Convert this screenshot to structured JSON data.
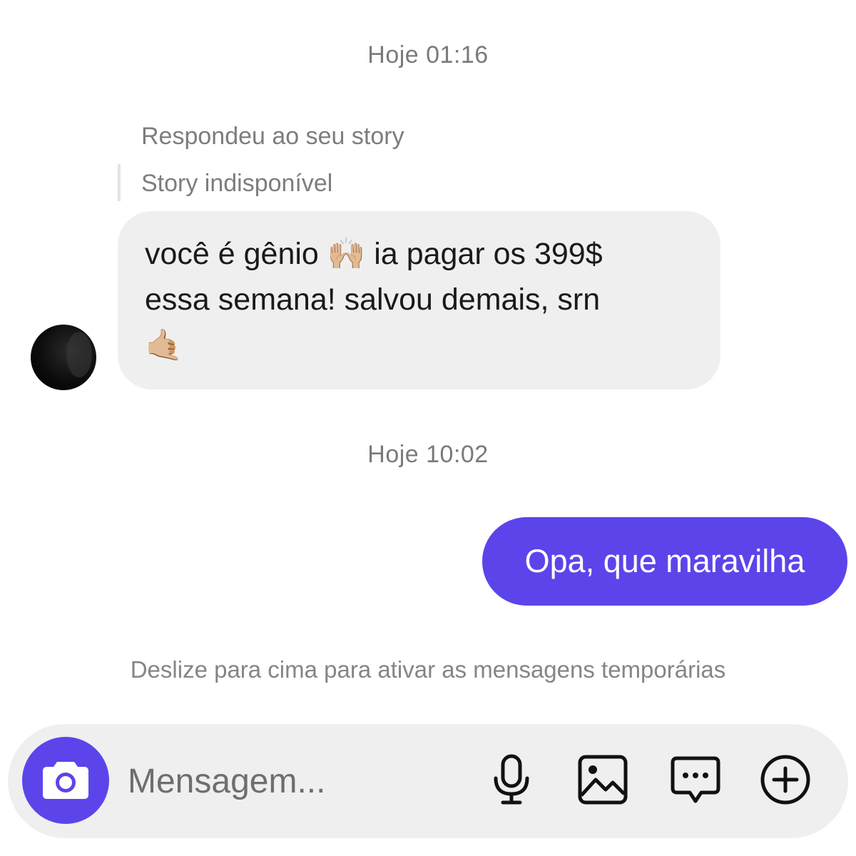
{
  "conversation": {
    "timestamp_1": "Hoje 01:16",
    "reply_header": "Respondeu ao seu story",
    "reply_story": "Story indisponível",
    "incoming_message": "você é gênio 🙌🏼 ia pagar os 399$\nessa semana! salvou demais, srn\n🤙🏼",
    "timestamp_2": "Hoje 10:02",
    "outgoing_message": "Opa, que maravilha",
    "hint": "Deslize para cima para ativar as mensagens temporárias"
  },
  "composer": {
    "placeholder": "Mensagem...",
    "icons": [
      "camera-icon",
      "microphone-icon",
      "image-icon",
      "message-bubble-icon",
      "plus-circle-icon"
    ]
  },
  "colors": {
    "accent": "#5b45ea",
    "incoming_bubble": "#efefef",
    "muted_text": "#7d7d7d"
  }
}
